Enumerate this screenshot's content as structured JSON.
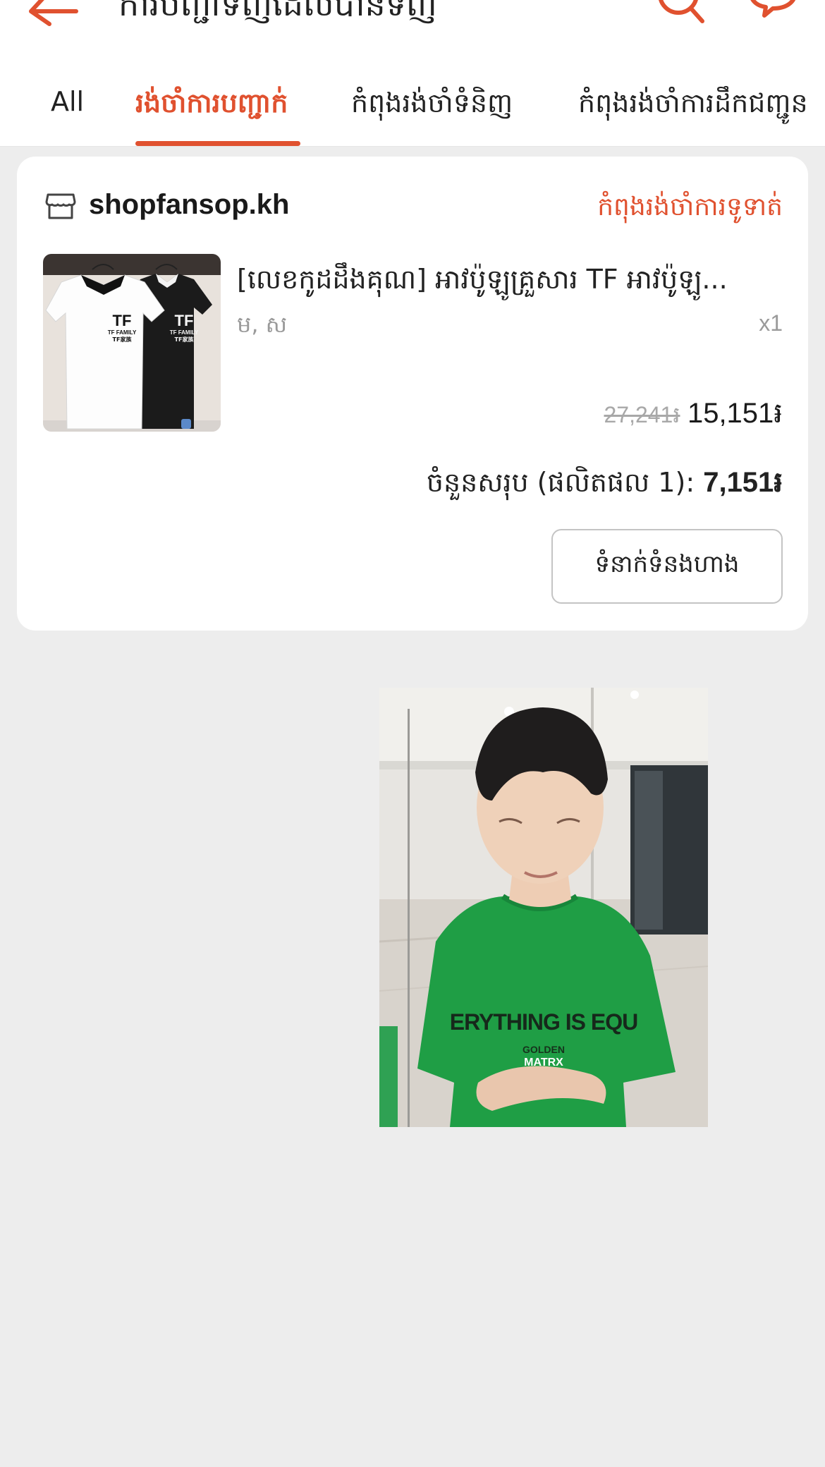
{
  "header": {
    "title": "ការបញ្ជាទិញដែលបានទិញ",
    "back_icon": "arrow-left-icon",
    "search_icon": "search-icon",
    "chat_icon": "chat-bubble-icon",
    "accent_color": "#e0512f"
  },
  "tabs": [
    {
      "label": "All",
      "active": false
    },
    {
      "label": "រង់ចាំការបញ្ជាក់",
      "active": true
    },
    {
      "label": "កំពុងរង់ចាំទំនិញ",
      "active": false
    },
    {
      "label": "កំពុងរង់ចាំការដឹកជញ្ជូន",
      "active": false
    }
  ],
  "order": {
    "shop_icon": "store-icon",
    "shop_name": "shopfansop.kh",
    "status": "កំពុងរង់ចាំការទូទាត់",
    "product": {
      "thumbnail_logo": "TF",
      "thumbnail_caption": "TF FAMILY",
      "thumbnail_caption_2": "TF家族",
      "name": "[លេខកូដដឹងគុណ] អាវប៉ូឡូគ្រួសារ TF អាវប៉ូឡូ...",
      "variant": "ម, ស",
      "quantity": "x1",
      "original_price": "27,241៛",
      "price": "15,151៛"
    },
    "total_label": "ចំនួនសរុប (ផលិតផល 1): ",
    "total_value": "7,151៛",
    "contact_button": "ទំនាក់ទំនងហាង"
  },
  "overlay_photo": {
    "slogan": "ERYTHING IS EQU",
    "brand_top": "GOLDEN",
    "brand_bottom": "MATRX"
  }
}
